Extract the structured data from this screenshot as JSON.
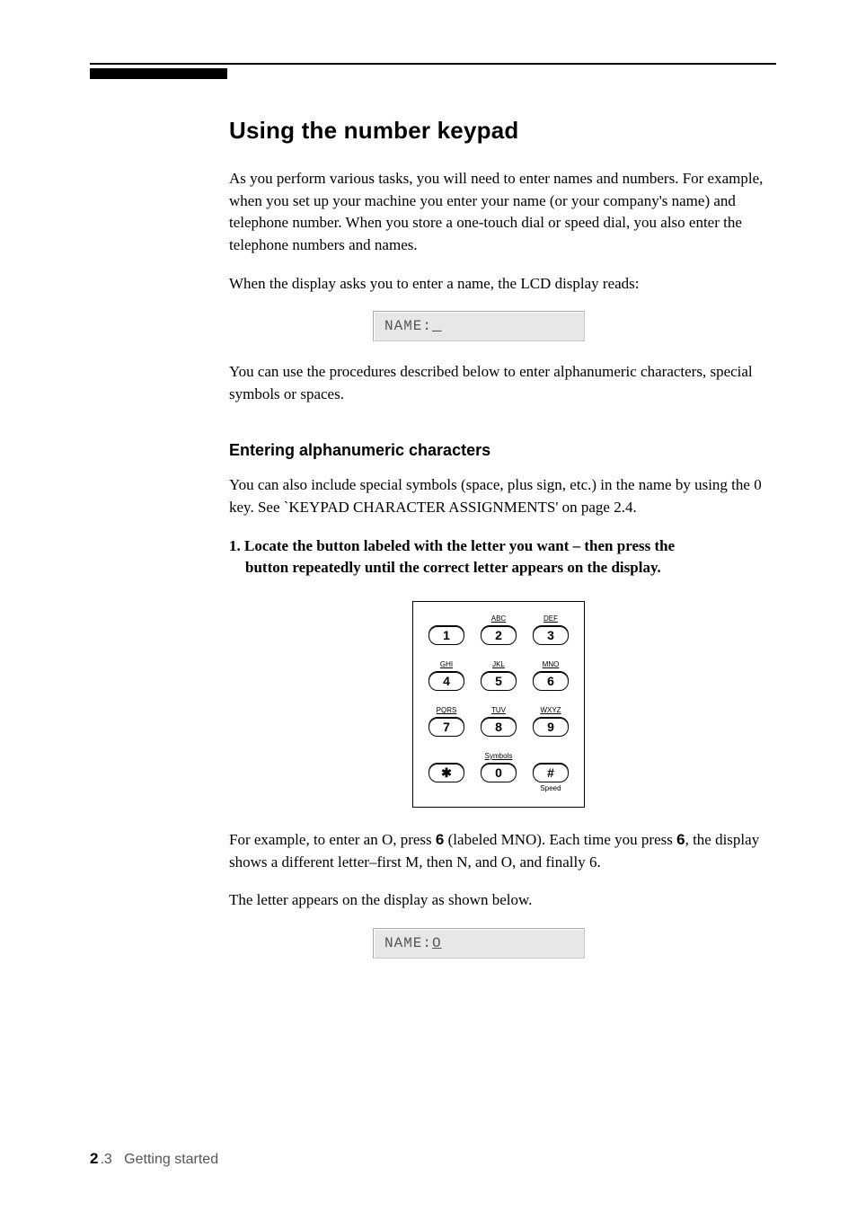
{
  "title": "Using the number keypad",
  "intro_p1": "As you perform various tasks, you will need to enter names and numbers. For example, when you set up your machine you enter your name (or your company's name) and telephone number. When you store a one-touch dial or speed dial, you also enter the telephone numbers and names.",
  "intro_p2": "When the display asks you to enter a name, the LCD display reads:",
  "lcd1_prefix": "NAME:",
  "lcd1_cursor": "_",
  "after_lcd1": "You can use the procedures described below to enter alphanumeric characters, special symbols or spaces.",
  "section2_title": "Entering alphanumeric characters",
  "section2_p": "You can also include special symbols (space, plus sign, etc.) in the name by using the 0 key. See `KEYPAD CHARACTER ASSIGNMENTS' on page 2.4.",
  "step1_line1": "1. Locate the button labeled with the letter you want – then press the",
  "step1_line2": "button repeatedly until the correct letter appears on the display.",
  "keypad": [
    [
      {
        "sup": "",
        "num": "1",
        "sub": ""
      },
      {
        "sup": "ABC",
        "num": "2",
        "sub": ""
      },
      {
        "sup": "DEF",
        "num": "3",
        "sub": ""
      }
    ],
    [
      {
        "sup": "GHI",
        "num": "4",
        "sub": ""
      },
      {
        "sup": "JKL",
        "num": "5",
        "sub": ""
      },
      {
        "sup": "MNO",
        "num": "6",
        "sub": ""
      }
    ],
    [
      {
        "sup": "PQRS",
        "num": "7",
        "sub": ""
      },
      {
        "sup": "TUV",
        "num": "8",
        "sub": ""
      },
      {
        "sup": "WXYZ",
        "num": "9",
        "sub": ""
      }
    ],
    [
      {
        "sup": "",
        "num": "✱",
        "sub": ""
      },
      {
        "sup": "Symbols",
        "num": "0",
        "sub": ""
      },
      {
        "sup": "",
        "num": "#",
        "sub": "Speed"
      }
    ]
  ],
  "example_p_a": "For example, to enter an O, press ",
  "example_b1": "6",
  "example_p_b": " (labeled MNO). Each time you press ",
  "example_b2": "6",
  "example_p_c": ", the display shows a different letter–first M, then N, and O, and finally 6.",
  "after_keypad2": "The letter appears on the display as shown below.",
  "lcd2_prefix": "NAME:",
  "lcd2_cursor": "O",
  "footer_page_big": "2",
  "footer_page_small": ".3",
  "footer_label": "Getting started"
}
